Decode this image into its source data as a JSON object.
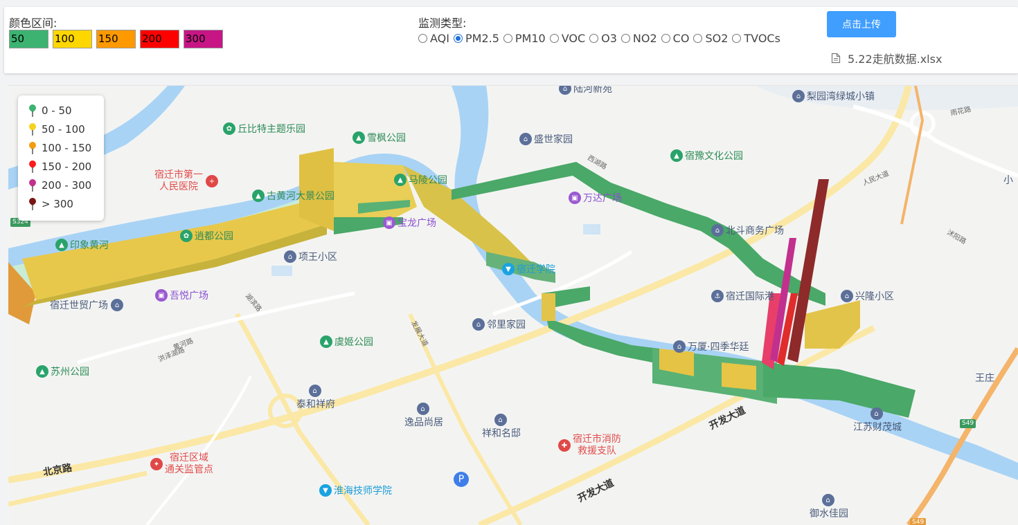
{
  "panel": {
    "color_label": "颜色区间:",
    "swatches": [
      {
        "label": "50",
        "color": "#3cb371"
      },
      {
        "label": "100",
        "color": "#ffd700"
      },
      {
        "label": "150",
        "color": "#ff9900"
      },
      {
        "label": "200",
        "color": "#ff0000"
      },
      {
        "label": "300",
        "color": "#c71585"
      }
    ],
    "monitor_label": "监测类型:",
    "types": [
      "AQI",
      "PM2.5",
      "PM10",
      "VOC",
      "O3",
      "NO2",
      "CO",
      "SO2",
      "TVOCs"
    ],
    "selected_type": "PM2.5",
    "upload_button": "点击上传",
    "file_name": "5.22走航数据.xlsx",
    "file_icon": "document-icon"
  },
  "legend": {
    "items": [
      {
        "label": "0 - 50",
        "color": "#3cb371"
      },
      {
        "label": "50 - 100",
        "color": "#f5d21f"
      },
      {
        "label": "100 - 150",
        "color": "#f39c12"
      },
      {
        "label": "150 - 200",
        "color": "#ff1a1a"
      },
      {
        "label": "200 - 300",
        "color": "#c2308e"
      },
      {
        "label": "> 300",
        "color": "#7a1515"
      }
    ]
  },
  "map": {
    "pois": {
      "luhe": "陆河新苑",
      "liyuan": "梨园湾绿城小镇",
      "qiubite": "丘比特主题乐园",
      "xuefeng": "雪枫公园",
      "shengshi": "盛世家园",
      "suyu": "宿豫文化公园",
      "hospital": "宿迁市第一\n人民医院",
      "guhuanghe": "古黄河大景公园",
      "maling": "马陵公园",
      "wanda": "万达广场",
      "xiao": "小",
      "yinxiang": "印象黄河",
      "xiaodu": "逍都公园",
      "baolong": "宝龙广场",
      "beidou": "北斗商务广场",
      "xiangwang": "项王小区",
      "suqianxueyuan": "宿迁学院",
      "wuyue": "吾悦广场",
      "shimao": "宿迁世贸广场",
      "gang": "宿迁国际港",
      "xinglong": "兴隆小区",
      "linli": "邻里家园",
      "yuji": "虞姬公园",
      "wansha": "万厦·四季华廷",
      "suzhou": "苏州公园",
      "taihe": "泰和祥府",
      "yipin": "逸品尚居",
      "xianghe": "祥和名邸",
      "xiaofang": "宿迁市消防\n救援支队",
      "wangzhuang": "王庄",
      "caimao": "江苏财茂城",
      "tongguan": "宿迁区域\n通关监管点",
      "huaihai": "淮海技师学院",
      "yushui": "御水佳园"
    },
    "roads": {
      "beijing": "北京路",
      "kaifa1": "开发大道",
      "kaifa2": "开发大道",
      "fazhan": "发展大道",
      "gonghu": "湖滨路",
      "hongze": "洪泽湖路",
      "huanghe": "黄河路",
      "renmin": "人民大道",
      "yuhua": "雨花路",
      "shuyang": "沭阳路",
      "xihu": "西湖路"
    },
    "shields": {
      "s324": "S324",
      "s49": "S49",
      "s49b": "S49"
    },
    "parking": "P"
  }
}
